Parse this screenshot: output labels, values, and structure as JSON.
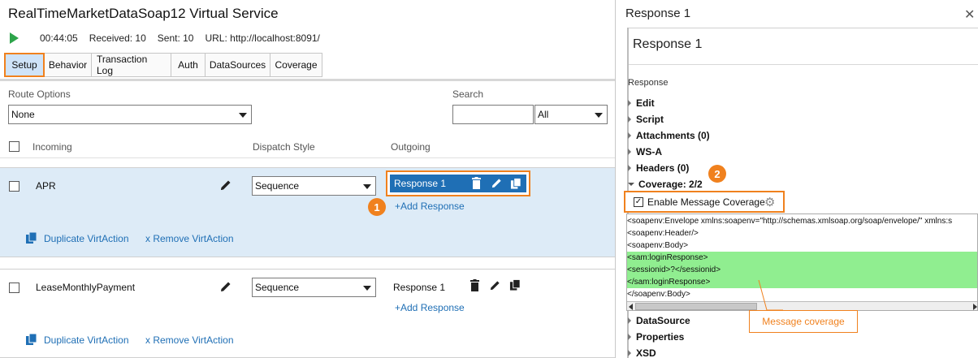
{
  "service": {
    "title": "RealTimeMarketDataSoap12 Virtual Service",
    "elapsed": "00:44:05",
    "received": "Received: 10",
    "sent": "Sent: 10",
    "url": "URL: http://localhost:8091/"
  },
  "tabs": [
    "Setup",
    "Behavior",
    "Transaction Log",
    "Auth",
    "DataSources",
    "Coverage"
  ],
  "route": {
    "label": "Route Options",
    "value": "None"
  },
  "search": {
    "label": "Search",
    "value": "",
    "scope": "All"
  },
  "columns": {
    "incoming": "Incoming",
    "dispatch": "Dispatch Style",
    "outgoing": "Outgoing"
  },
  "rows": [
    {
      "name": "APR",
      "dispatch": "Sequence",
      "response": "Response 1",
      "add_response": "+Add Response",
      "duplicate": "Duplicate VirtAction",
      "remove": "x Remove VirtAction",
      "selected": true
    },
    {
      "name": "LeaseMonthlyPayment",
      "dispatch": "Sequence",
      "response": "Response 1",
      "add_response": "+Add Response",
      "duplicate": "Duplicate VirtAction",
      "remove": "x Remove VirtAction",
      "selected": false
    }
  ],
  "badges": {
    "one": "1",
    "two": "2"
  },
  "panel": {
    "title": "Response 1",
    "subtitle": "Response 1",
    "section_label": "Response",
    "tree": [
      "Edit",
      "Script",
      "Attachments (0)",
      "WS-A",
      "Headers (0)"
    ],
    "coverage_node": "Coverage: 2/2",
    "enable_coverage": "Enable Message Coverage",
    "enable_coverage_checked": true,
    "tree_after": [
      "DataSource",
      "Properties",
      "XSD"
    ]
  },
  "xml_lines": [
    {
      "text": "<soapenv:Envelope xmlns:soapenv=\"http://schemas.xmlsoap.org/soap/envelope/\" xmlns:s",
      "covered": false
    },
    {
      "text": "  <soapenv:Header/>",
      "covered": false
    },
    {
      "text": "  <soapenv:Body>",
      "covered": false
    },
    {
      "text": "    <sam:loginResponse>",
      "covered": true
    },
    {
      "text": "      <sessionid>?</sessionid>",
      "covered": true
    },
    {
      "text": "    </sam:loginResponse>",
      "covered": true
    },
    {
      "text": "  </soapenv:Body>",
      "covered": false
    }
  ],
  "callout": "Message coverage",
  "colors": {
    "accent_orange": "#f0811e",
    "selection_blue": "#1f6fb5",
    "row_highlight": "#ddebf7",
    "coverage_green": "#90ee90",
    "play_green": "#2da44a"
  },
  "icons": [
    "play-icon",
    "pencil-icon",
    "trash-icon",
    "copy-icon",
    "gear-icon",
    "close-icon"
  ]
}
